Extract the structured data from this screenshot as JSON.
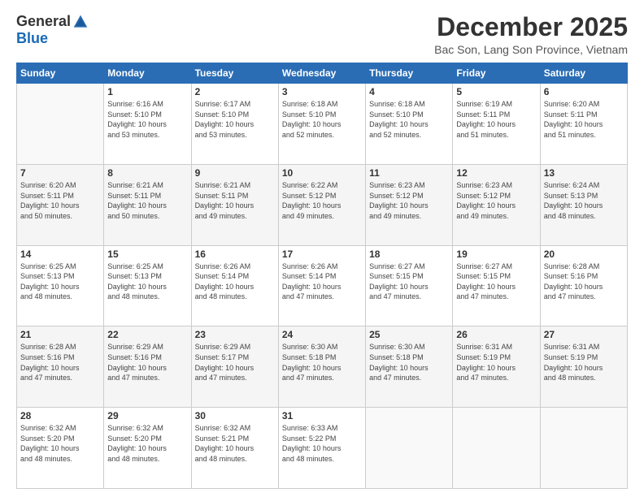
{
  "logo": {
    "general": "General",
    "blue": "Blue"
  },
  "title": "December 2025",
  "location": "Bac Son, Lang Son Province, Vietnam",
  "days_of_week": [
    "Sunday",
    "Monday",
    "Tuesday",
    "Wednesday",
    "Thursday",
    "Friday",
    "Saturday"
  ],
  "weeks": [
    [
      {
        "day": "",
        "sunrise": "",
        "sunset": "",
        "daylight": ""
      },
      {
        "day": "1",
        "sunrise": "Sunrise: 6:16 AM",
        "sunset": "Sunset: 5:10 PM",
        "daylight": "Daylight: 10 hours and 53 minutes."
      },
      {
        "day": "2",
        "sunrise": "Sunrise: 6:17 AM",
        "sunset": "Sunset: 5:10 PM",
        "daylight": "Daylight: 10 hours and 53 minutes."
      },
      {
        "day": "3",
        "sunrise": "Sunrise: 6:18 AM",
        "sunset": "Sunset: 5:10 PM",
        "daylight": "Daylight: 10 hours and 52 minutes."
      },
      {
        "day": "4",
        "sunrise": "Sunrise: 6:18 AM",
        "sunset": "Sunset: 5:10 PM",
        "daylight": "Daylight: 10 hours and 52 minutes."
      },
      {
        "day": "5",
        "sunrise": "Sunrise: 6:19 AM",
        "sunset": "Sunset: 5:11 PM",
        "daylight": "Daylight: 10 hours and 51 minutes."
      },
      {
        "day": "6",
        "sunrise": "Sunrise: 6:20 AM",
        "sunset": "Sunset: 5:11 PM",
        "daylight": "Daylight: 10 hours and 51 minutes."
      }
    ],
    [
      {
        "day": "7",
        "sunrise": "Sunrise: 6:20 AM",
        "sunset": "Sunset: 5:11 PM",
        "daylight": "Daylight: 10 hours and 50 minutes."
      },
      {
        "day": "8",
        "sunrise": "Sunrise: 6:21 AM",
        "sunset": "Sunset: 5:11 PM",
        "daylight": "Daylight: 10 hours and 50 minutes."
      },
      {
        "day": "9",
        "sunrise": "Sunrise: 6:21 AM",
        "sunset": "Sunset: 5:11 PM",
        "daylight": "Daylight: 10 hours and 49 minutes."
      },
      {
        "day": "10",
        "sunrise": "Sunrise: 6:22 AM",
        "sunset": "Sunset: 5:12 PM",
        "daylight": "Daylight: 10 hours and 49 minutes."
      },
      {
        "day": "11",
        "sunrise": "Sunrise: 6:23 AM",
        "sunset": "Sunset: 5:12 PM",
        "daylight": "Daylight: 10 hours and 49 minutes."
      },
      {
        "day": "12",
        "sunrise": "Sunrise: 6:23 AM",
        "sunset": "Sunset: 5:12 PM",
        "daylight": "Daylight: 10 hours and 49 minutes."
      },
      {
        "day": "13",
        "sunrise": "Sunrise: 6:24 AM",
        "sunset": "Sunset: 5:13 PM",
        "daylight": "Daylight: 10 hours and 48 minutes."
      }
    ],
    [
      {
        "day": "14",
        "sunrise": "Sunrise: 6:25 AM",
        "sunset": "Sunset: 5:13 PM",
        "daylight": "Daylight: 10 hours and 48 minutes."
      },
      {
        "day": "15",
        "sunrise": "Sunrise: 6:25 AM",
        "sunset": "Sunset: 5:13 PM",
        "daylight": "Daylight: 10 hours and 48 minutes."
      },
      {
        "day": "16",
        "sunrise": "Sunrise: 6:26 AM",
        "sunset": "Sunset: 5:14 PM",
        "daylight": "Daylight: 10 hours and 48 minutes."
      },
      {
        "day": "17",
        "sunrise": "Sunrise: 6:26 AM",
        "sunset": "Sunset: 5:14 PM",
        "daylight": "Daylight: 10 hours and 47 minutes."
      },
      {
        "day": "18",
        "sunrise": "Sunrise: 6:27 AM",
        "sunset": "Sunset: 5:15 PM",
        "daylight": "Daylight: 10 hours and 47 minutes."
      },
      {
        "day": "19",
        "sunrise": "Sunrise: 6:27 AM",
        "sunset": "Sunset: 5:15 PM",
        "daylight": "Daylight: 10 hours and 47 minutes."
      },
      {
        "day": "20",
        "sunrise": "Sunrise: 6:28 AM",
        "sunset": "Sunset: 5:16 PM",
        "daylight": "Daylight: 10 hours and 47 minutes."
      }
    ],
    [
      {
        "day": "21",
        "sunrise": "Sunrise: 6:28 AM",
        "sunset": "Sunset: 5:16 PM",
        "daylight": "Daylight: 10 hours and 47 minutes."
      },
      {
        "day": "22",
        "sunrise": "Sunrise: 6:29 AM",
        "sunset": "Sunset: 5:16 PM",
        "daylight": "Daylight: 10 hours and 47 minutes."
      },
      {
        "day": "23",
        "sunrise": "Sunrise: 6:29 AM",
        "sunset": "Sunset: 5:17 PM",
        "daylight": "Daylight: 10 hours and 47 minutes."
      },
      {
        "day": "24",
        "sunrise": "Sunrise: 6:30 AM",
        "sunset": "Sunset: 5:18 PM",
        "daylight": "Daylight: 10 hours and 47 minutes."
      },
      {
        "day": "25",
        "sunrise": "Sunrise: 6:30 AM",
        "sunset": "Sunset: 5:18 PM",
        "daylight": "Daylight: 10 hours and 47 minutes."
      },
      {
        "day": "26",
        "sunrise": "Sunrise: 6:31 AM",
        "sunset": "Sunset: 5:19 PM",
        "daylight": "Daylight: 10 hours and 47 minutes."
      },
      {
        "day": "27",
        "sunrise": "Sunrise: 6:31 AM",
        "sunset": "Sunset: 5:19 PM",
        "daylight": "Daylight: 10 hours and 48 minutes."
      }
    ],
    [
      {
        "day": "28",
        "sunrise": "Sunrise: 6:32 AM",
        "sunset": "Sunset: 5:20 PM",
        "daylight": "Daylight: 10 hours and 48 minutes."
      },
      {
        "day": "29",
        "sunrise": "Sunrise: 6:32 AM",
        "sunset": "Sunset: 5:20 PM",
        "daylight": "Daylight: 10 hours and 48 minutes."
      },
      {
        "day": "30",
        "sunrise": "Sunrise: 6:32 AM",
        "sunset": "Sunset: 5:21 PM",
        "daylight": "Daylight: 10 hours and 48 minutes."
      },
      {
        "day": "31",
        "sunrise": "Sunrise: 6:33 AM",
        "sunset": "Sunset: 5:22 PM",
        "daylight": "Daylight: 10 hours and 48 minutes."
      },
      {
        "day": "",
        "sunrise": "",
        "sunset": "",
        "daylight": ""
      },
      {
        "day": "",
        "sunrise": "",
        "sunset": "",
        "daylight": ""
      },
      {
        "day": "",
        "sunrise": "",
        "sunset": "",
        "daylight": ""
      }
    ]
  ]
}
